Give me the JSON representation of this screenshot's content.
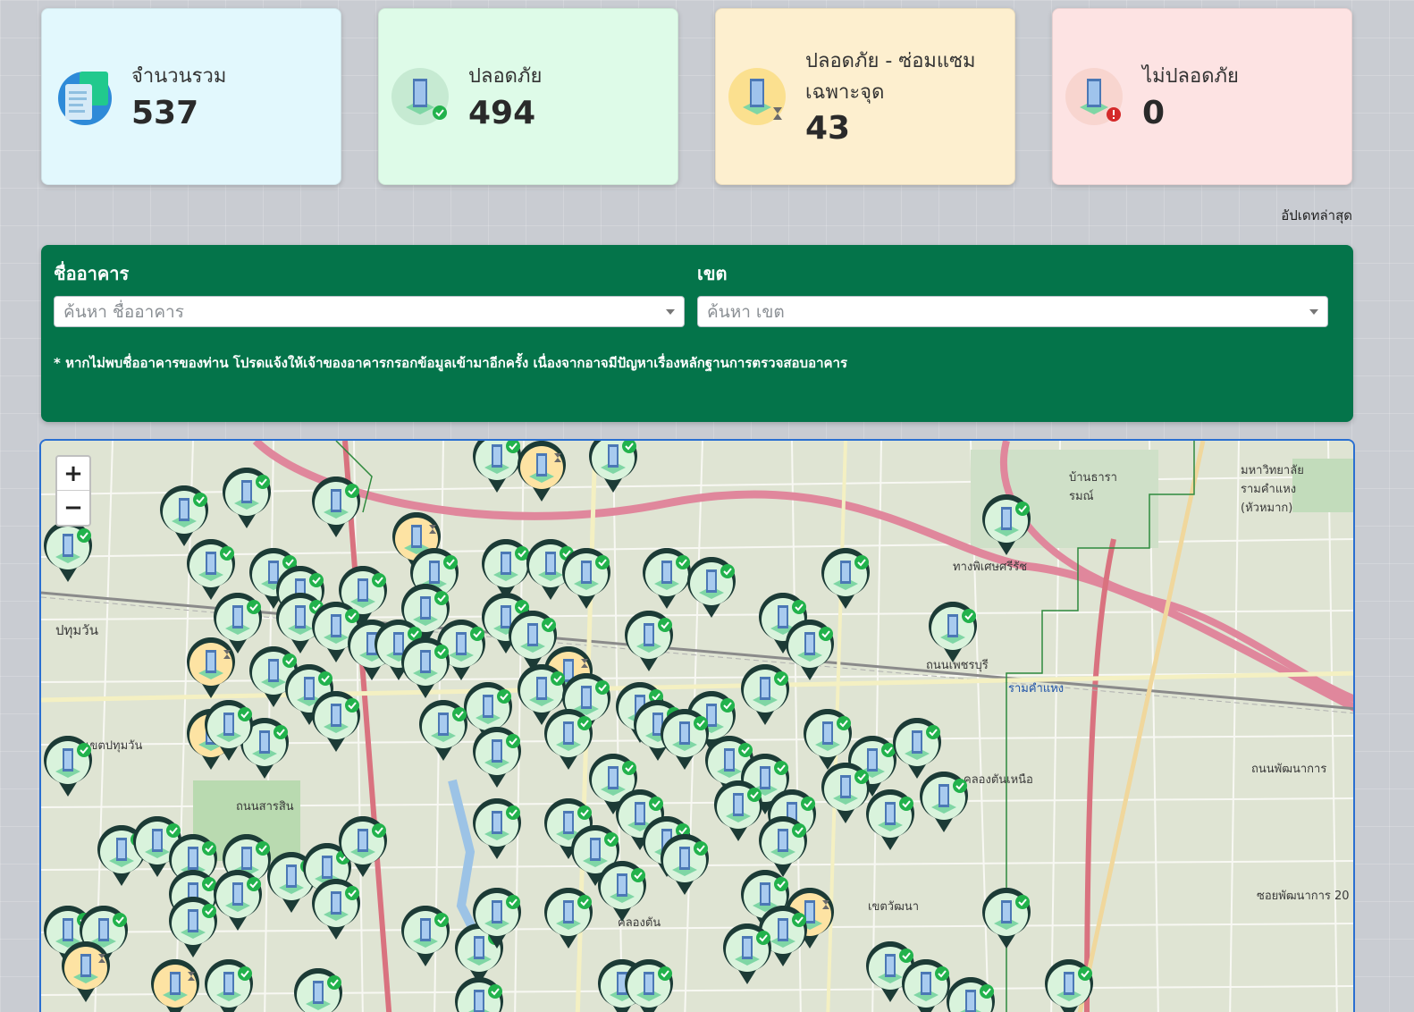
{
  "stats": [
    {
      "label": "จำนวนรวม",
      "value": "537",
      "icon": "document-icon"
    },
    {
      "label": "ปลอดภัย",
      "value": "494",
      "icon": "building-safe-icon"
    },
    {
      "label": "ปลอดภัย - ซ่อมแซมเฉพาะจุด",
      "value": "43",
      "icon": "building-repair-icon"
    },
    {
      "label": "ไม่ปลอดภัย",
      "value": "0",
      "icon": "building-unsafe-icon"
    }
  ],
  "updated_label": "อัปเดทล่าสุด",
  "filter": {
    "building_label": "ชื่ออาคาร",
    "building_placeholder": "ค้นหา ชื่ออาคาร",
    "district_label": "เขต",
    "district_placeholder": "ค้นหา เขต",
    "note": "* หากไม่พบชื่ออาคารของท่าน โปรดแจ้งให้เจ้าของอาคารกรอกข้อมูลเข้ามาอีกครั้ง เนื่องจากอาจมีปัญหาเรื่องหลักฐานการตรวจสอบอาคาร"
  },
  "map": {
    "zoom_in": "+",
    "zoom_out": "−",
    "labels": {
      "l1": "ปทุมวัน",
      "l2": "เขตปทุมวัน",
      "l3": "คลองตัน",
      "l4": "คลองตันเหนือ",
      "l5": "เขตวัฒนา",
      "l6": "รามคำแหง",
      "l7": "บ้านธารา รมณ์",
      "l8": "มหาวิทยาลัย รามคำแหง (หัวหมาก)",
      "l9": "ถนนพัฒนาการ",
      "l10": "ซอยพัฒนาการ 20",
      "l11": "ทางพิเศษศรีรัช",
      "l12": "ถนนเพชรบุรี",
      "l13": "ถนนสารสิน"
    },
    "colors": {
      "safe": "#d9f3dc",
      "repair": "#fde3a3",
      "ring": "#1c3b36",
      "check": "#22b24c"
    }
  }
}
